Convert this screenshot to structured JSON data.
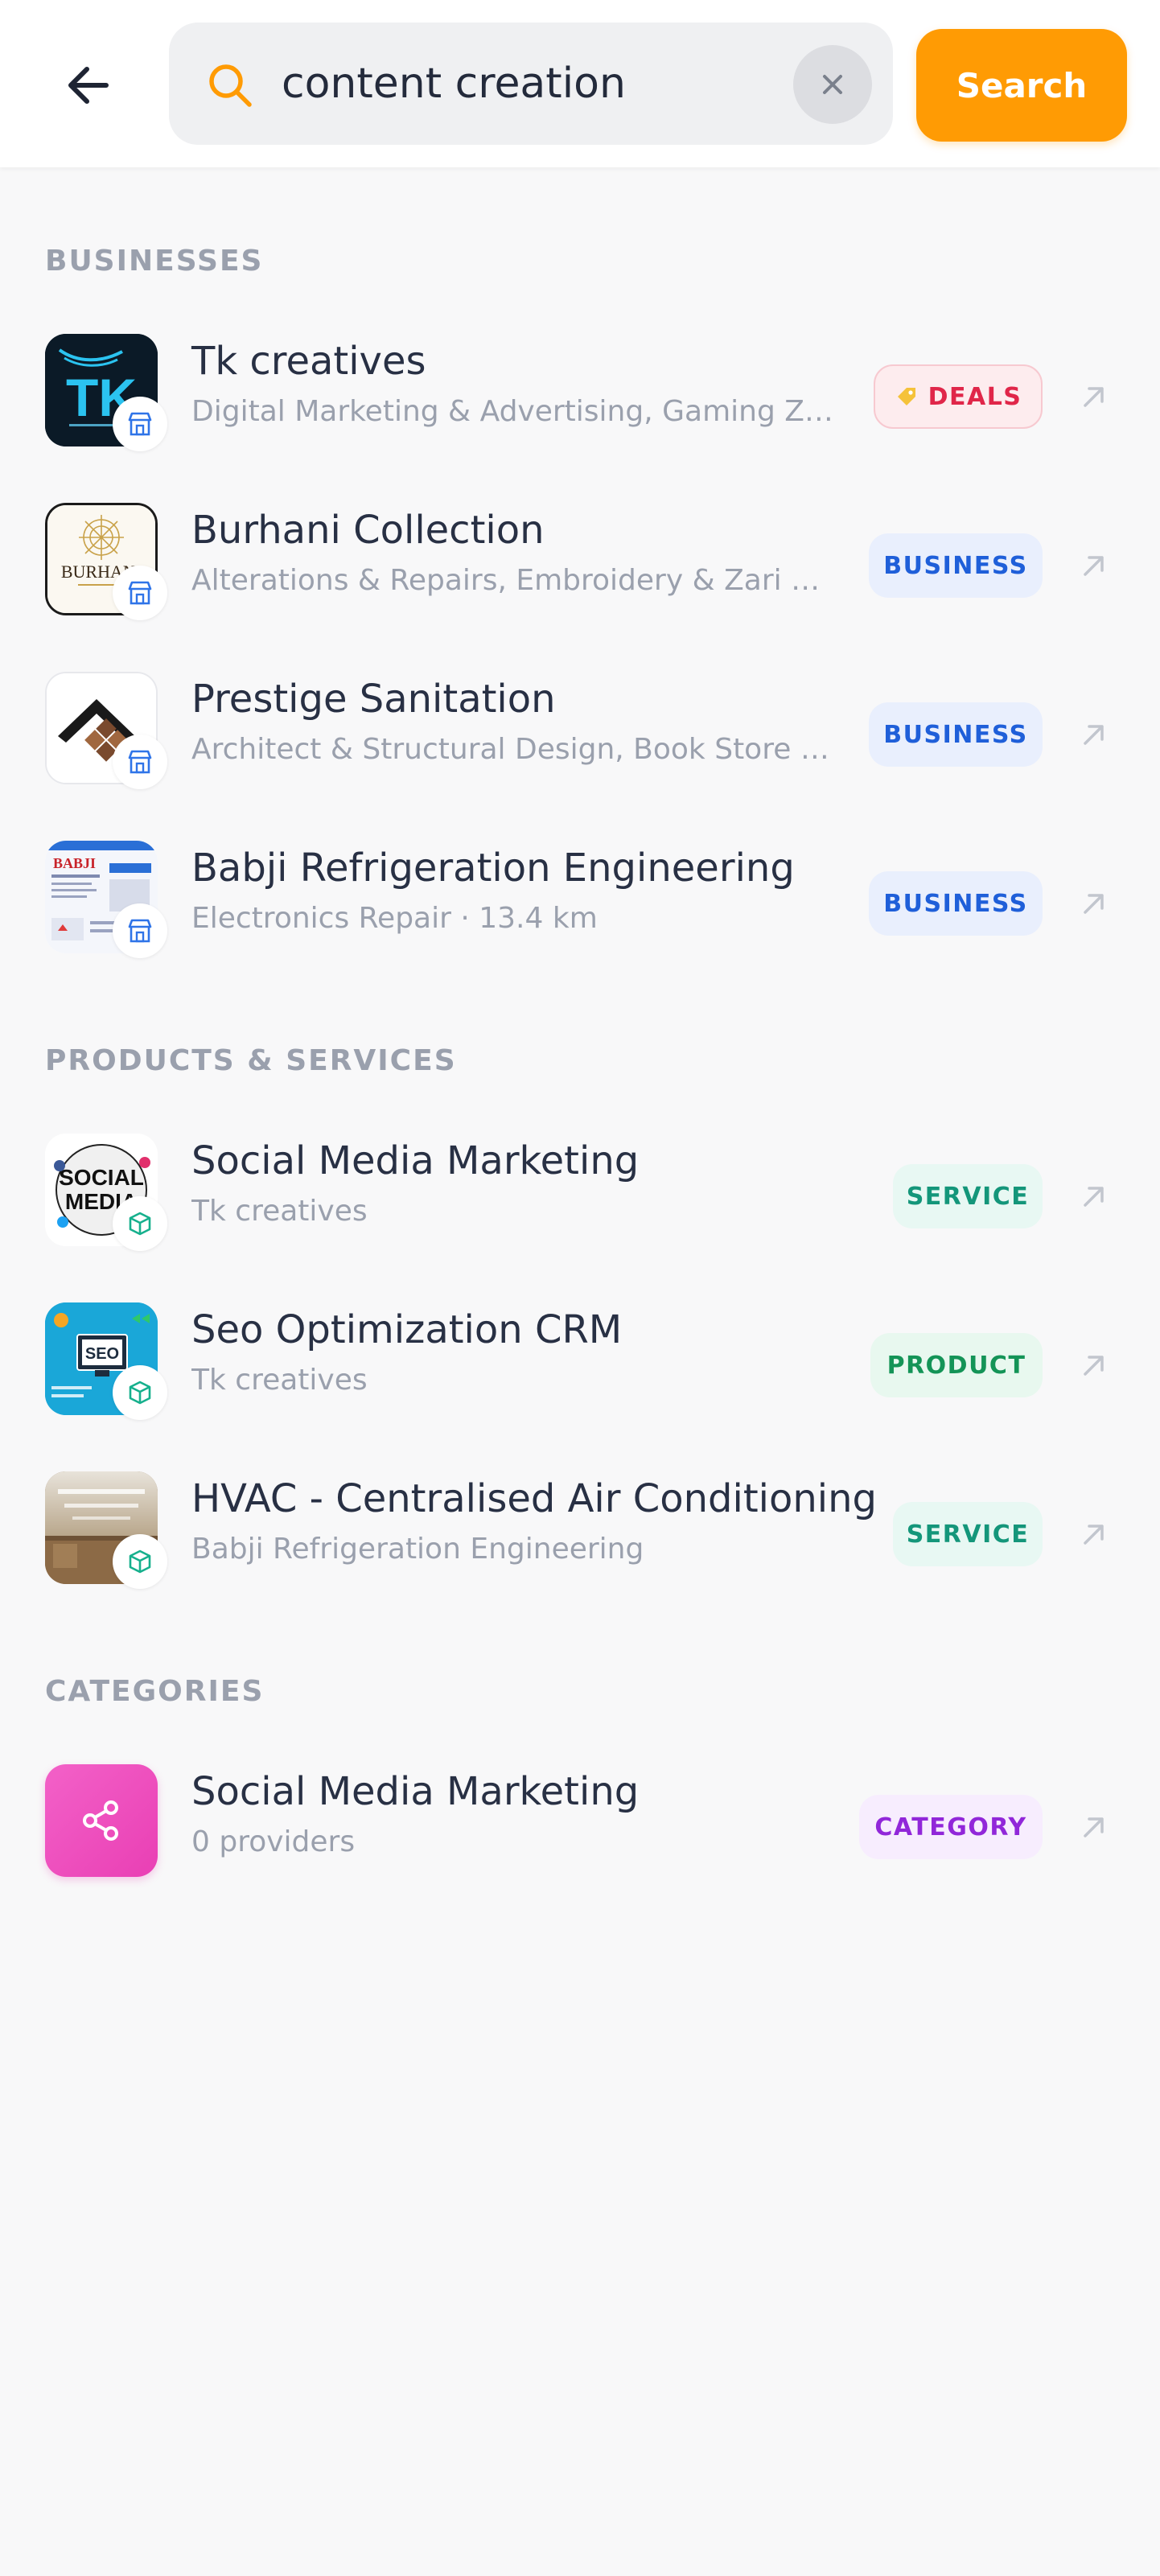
{
  "search": {
    "query": "content creation",
    "button_label": "Search",
    "icons": {
      "back": "back-arrow-icon",
      "search": "search-icon",
      "clear": "close-icon"
    }
  },
  "colors": {
    "accent": "#ff9b04",
    "deals_bg": "#fdecee",
    "deals_fg": "#e02649",
    "business_bg": "#e9effd",
    "business_fg": "#1f5fd9",
    "service_bg": "#e8f8f3",
    "service_fg": "#14967a",
    "product_bg": "#e8f8ef",
    "product_fg": "#149457",
    "category_bg": "#f7edfe",
    "category_fg": "#9127d9"
  },
  "sections": {
    "businesses": "BUSINESSES",
    "products": "PRODUCTS & SERVICES",
    "categories": "CATEGORIES"
  },
  "businesses": [
    {
      "title": "Tk creatives",
      "subtitle": "Digital Marketing & Advertising, Gaming Zone, Graphic Design",
      "tag": "DEALS",
      "badge_icon": "store-icon"
    },
    {
      "title": "Burhani Collection",
      "subtitle": "Alterations & Repairs, Embroidery & Zari Work",
      "tag": "BUSINESS",
      "badge_icon": "store-icon"
    },
    {
      "title": "Prestige Sanitation",
      "subtitle": "Architect & Structural Design, Book Store & More",
      "tag": "BUSINESS",
      "badge_icon": "store-icon"
    },
    {
      "title": "Babji Refrigeration Engineering",
      "subtitle": "Electronics Repair · 13.4 km",
      "tag": "BUSINESS",
      "badge_icon": "store-icon"
    }
  ],
  "products": [
    {
      "title": "Social Media Marketing",
      "subtitle": "Tk creatives",
      "tag": "SERVICE",
      "badge_icon": "box-icon"
    },
    {
      "title": "Seo Optimization CRM",
      "subtitle": "Tk creatives",
      "tag": "PRODUCT",
      "badge_icon": "box-icon"
    },
    {
      "title": "HVAC - Centralised Air Conditioning",
      "subtitle": "Babji Refrigeration Engineering",
      "tag": "SERVICE",
      "badge_icon": "box-icon"
    }
  ],
  "categories": [
    {
      "title": "Social Media Marketing",
      "subtitle": "0 providers",
      "tag": "CATEGORY",
      "icon": "share-icon"
    }
  ],
  "thumb_text": {
    "tk": "TK",
    "burhani": "BURHANI",
    "babji": "BABJI",
    "social_line1": "SOCIAL",
    "social_line2": "MEDIA",
    "seo": "SEO"
  }
}
